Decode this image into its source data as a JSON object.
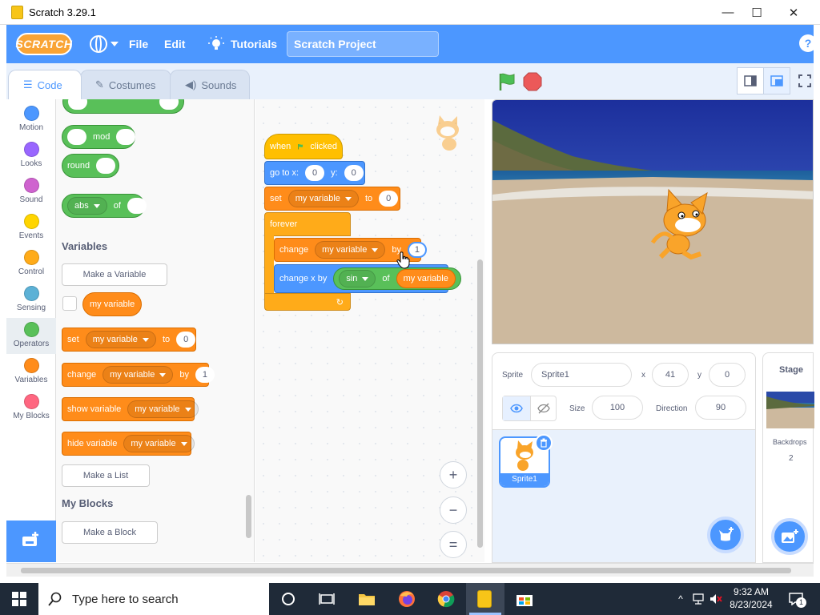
{
  "window": {
    "title": "Scratch 3.29.1",
    "min": "—",
    "max": "☐",
    "close": "✕"
  },
  "menubar": {
    "logo": "SCRATCH",
    "file": "File",
    "edit": "Edit",
    "tutorials": "Tutorials",
    "project_title": "Scratch Project",
    "help": "?"
  },
  "tabs": {
    "code": "Code",
    "costumes": "Costumes",
    "sounds": "Sounds"
  },
  "categories": [
    {
      "label": "Motion",
      "color": "#4c97ff"
    },
    {
      "label": "Looks",
      "color": "#9966ff"
    },
    {
      "label": "Sound",
      "color": "#cf63cf"
    },
    {
      "label": "Events",
      "color": "#ffd500"
    },
    {
      "label": "Control",
      "color": "#ffab19"
    },
    {
      "label": "Sensing",
      "color": "#5cb1d6"
    },
    {
      "label": "Operators",
      "color": "#59c059"
    },
    {
      "label": "Variables",
      "color": "#ff8c1a"
    },
    {
      "label": "My Blocks",
      "color": "#ff6680"
    }
  ],
  "palette": {
    "mod": "mod",
    "round": "round",
    "abs": "abs",
    "of": "of",
    "variables_heading": "Variables",
    "make_variable": "Make a Variable",
    "my_variable": "my variable",
    "set": "set",
    "to": "to",
    "set_value": "0",
    "change": "change",
    "by": "by",
    "change_value": "1",
    "show_variable": "show variable",
    "hide_variable": "hide variable",
    "make_list": "Make a List",
    "my_blocks_heading": "My Blocks",
    "make_block": "Make a Block"
  },
  "script": {
    "when": "when",
    "clicked": "clicked",
    "go_to_x": "go to x:",
    "x_val": "0",
    "y": "y:",
    "y_val": "0",
    "set": "set",
    "variable": "my variable",
    "to": "to",
    "set_val": "0",
    "forever": "forever",
    "change": "change",
    "by": "by",
    "change_val": "1",
    "change_x_by": "change x by",
    "sin": "sin",
    "of": "of",
    "loop_arrow": "↻",
    "zoom_in": "+",
    "zoom_out": "−",
    "zoom_reset": "="
  },
  "sprite": {
    "label": "Sprite",
    "name": "Sprite1",
    "x_label": "x",
    "x": "41",
    "y_label": "y",
    "y": "0",
    "show_label": "Show",
    "size_label": "Size",
    "size": "100",
    "direction_label": "Direction",
    "direction": "90",
    "tile_name": "Sprite1"
  },
  "stage_panel": {
    "title": "Stage",
    "backdrops_label": "Backdrops",
    "backdrops_count": "2"
  },
  "taskbar": {
    "search_placeholder": "Type here to search",
    "time": "9:32 AM",
    "date": "8/23/2024",
    "notif_count": "1"
  }
}
